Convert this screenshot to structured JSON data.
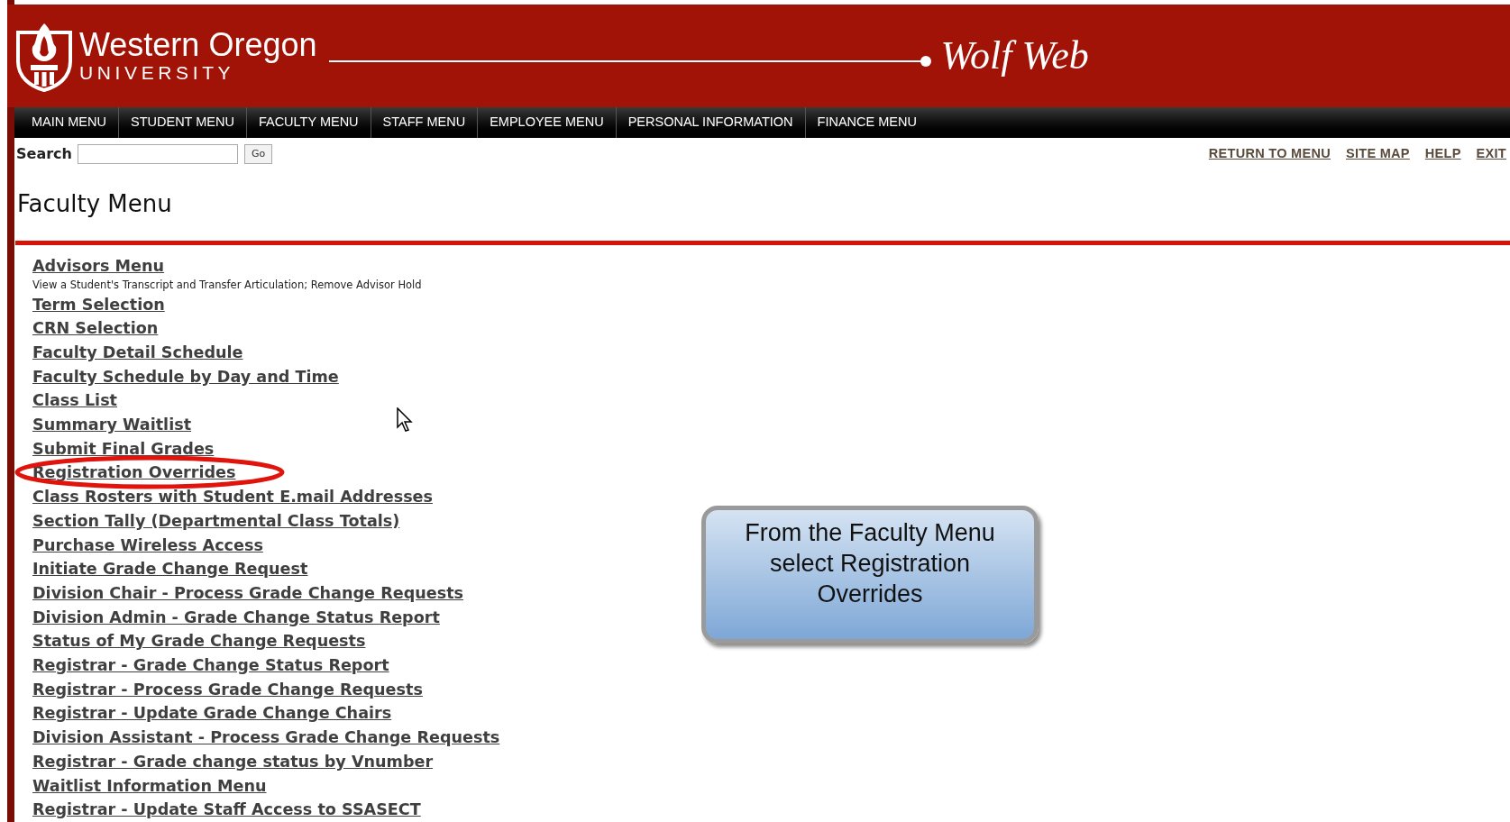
{
  "header": {
    "university_name": "Western Oregon",
    "university_subtitle": "UNIVERSITY",
    "site_title": "Wolf Web"
  },
  "nav_tabs": [
    "MAIN MENU",
    "STUDENT MENU",
    "FACULTY MENU",
    "STAFF MENU",
    "EMPLOYEE MENU",
    "PERSONAL INFORMATION",
    "FINANCE MENU"
  ],
  "search": {
    "label": "Search",
    "button": "Go"
  },
  "utility_links": [
    "RETURN TO MENU",
    "SITE MAP",
    "HELP",
    "EXIT"
  ],
  "page_title": "Faculty Menu",
  "menu_links": [
    {
      "label": "Advisors Menu",
      "description": "View a Student's Transcript and Transfer Articulation; Remove Advisor Hold",
      "highlighted": false
    },
    {
      "label": "Term Selection",
      "highlighted": false
    },
    {
      "label": "CRN Selection",
      "highlighted": false
    },
    {
      "label": "Faculty Detail Schedule",
      "highlighted": false
    },
    {
      "label": "Faculty Schedule by Day and Time",
      "highlighted": false
    },
    {
      "label": "Class List",
      "highlighted": false
    },
    {
      "label": "Summary Waitlist",
      "highlighted": false
    },
    {
      "label": "Submit Final Grades",
      "highlighted": false
    },
    {
      "label": "Registration Overrides",
      "highlighted": true
    },
    {
      "label": "Class Rosters with Student E.mail Addresses",
      "highlighted": false
    },
    {
      "label": "Section Tally (Departmental Class Totals)",
      "highlighted": false
    },
    {
      "label": "Purchase Wireless Access",
      "highlighted": false
    },
    {
      "label": "Initiate Grade Change Request",
      "highlighted": false
    },
    {
      "label": "Division Chair - Process Grade Change Requests",
      "highlighted": false
    },
    {
      "label": "Division Admin - Grade Change Status Report",
      "highlighted": false
    },
    {
      "label": "Status of My Grade Change Requests",
      "highlighted": false
    },
    {
      "label": "Registrar - Grade Change Status Report",
      "highlighted": false
    },
    {
      "label": "Registrar - Process Grade Change Requests",
      "highlighted": false
    },
    {
      "label": "Registrar - Update Grade Change Chairs",
      "highlighted": false
    },
    {
      "label": "Division Assistant - Process Grade Change Requests",
      "highlighted": false
    },
    {
      "label": "Registrar - Grade change status by Vnumber",
      "highlighted": false
    },
    {
      "label": "Waitlist Information Menu",
      "highlighted": false
    },
    {
      "label": "Registrar - Update Staff Access to SSASECT",
      "highlighted": false
    }
  ],
  "callout": {
    "text": "From the Faculty Menu select Registration Overrides"
  }
}
